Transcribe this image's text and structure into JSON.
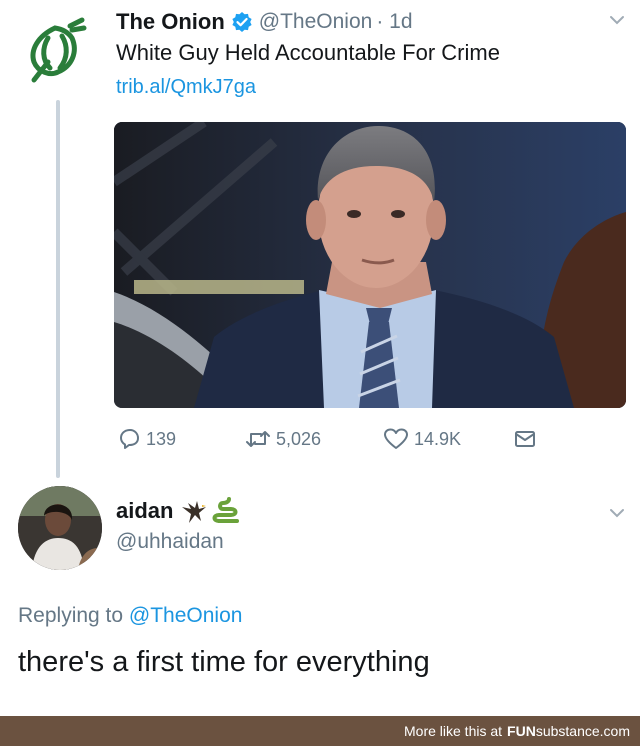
{
  "tweet": {
    "author_name": "The Onion",
    "handle": "@TheOnion",
    "time": "· 1d",
    "text": "White Guy Held Accountable For Crime",
    "link": "trib.al/QmkJ7ga",
    "stats": {
      "replies": "139",
      "retweets": "5,026",
      "likes": "14.9K"
    }
  },
  "reply": {
    "author_name": "aidan",
    "handle": "@uhhaidan",
    "replying_prefix": "Replying to",
    "replying_to": "@TheOnion",
    "text": "there's a first time for everything"
  },
  "footer": {
    "prefix": "More like this at",
    "brand_bold": "FUN",
    "brand_rest": "substance.com"
  },
  "colors": {
    "onion_green": "#2a7d3a",
    "link_blue": "#1b95e0",
    "muted_gray": "#657786",
    "footer_brown": "#6b5240"
  }
}
